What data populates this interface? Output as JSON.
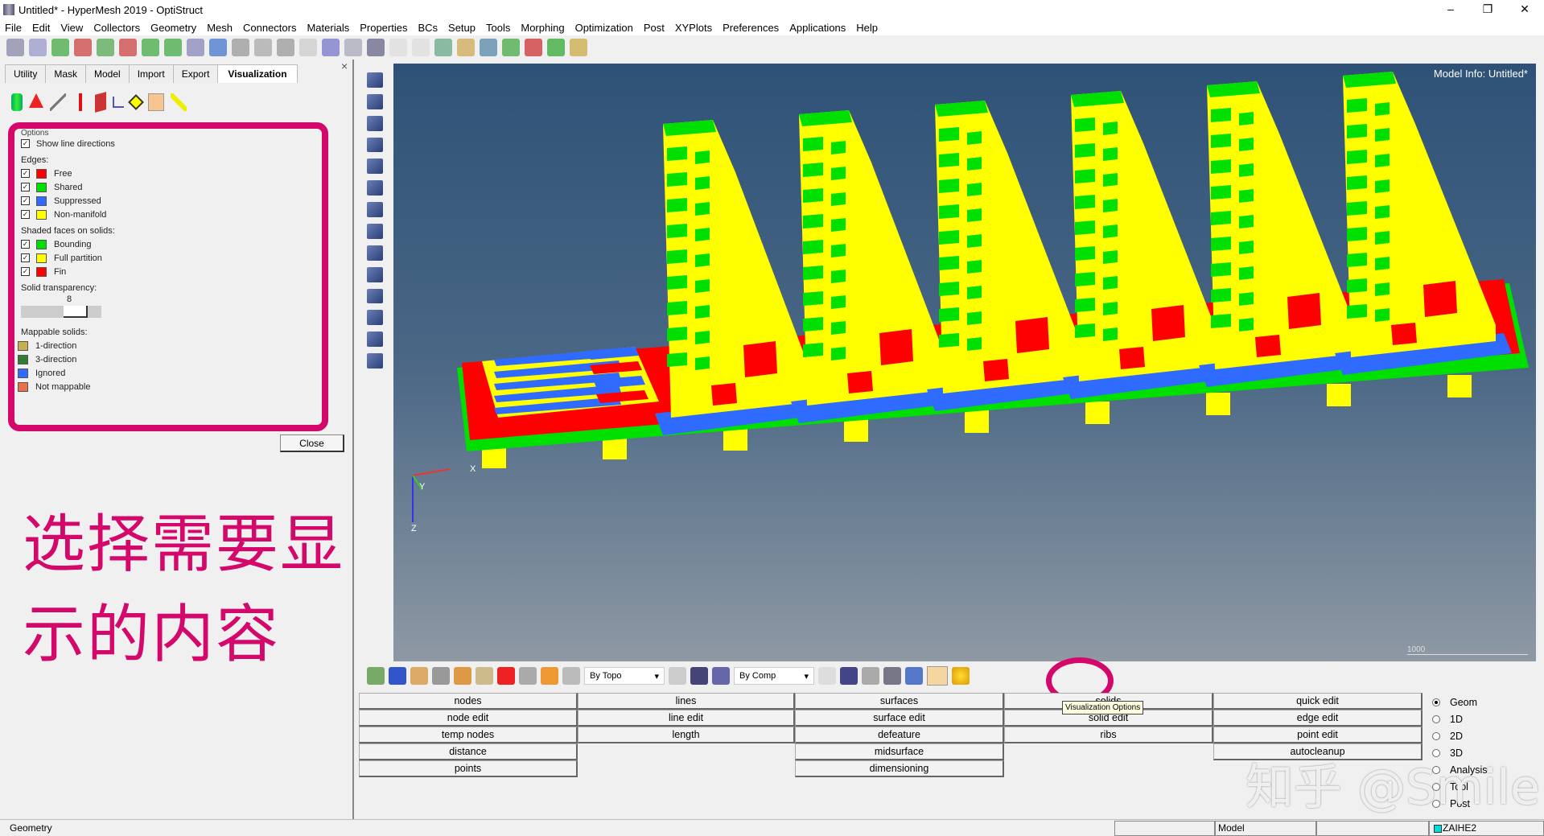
{
  "window": {
    "title": "Untitled* - HyperMesh 2019 - OptiStruct",
    "minimize": "–",
    "maximize": "❐",
    "close": "✕"
  },
  "menu": [
    "File",
    "Edit",
    "View",
    "Collectors",
    "Geometry",
    "Mesh",
    "Connectors",
    "Materials",
    "Properties",
    "BCs",
    "Setup",
    "Tools",
    "Morphing",
    "Optimization",
    "Post",
    "XYPlots",
    "Preferences",
    "Applications",
    "Help"
  ],
  "panel": {
    "tabs": [
      "Utility",
      "Mask",
      "Model",
      "Import",
      "Export",
      "Visualization"
    ],
    "active_tab": "Visualization",
    "close_x": "×",
    "options_label": "Options",
    "show_line_directions": "Show line directions",
    "edges_label": "Edges:",
    "edges": [
      {
        "label": "Free",
        "color": "#ff0000",
        "checked": true
      },
      {
        "label": "Shared",
        "color": "#00e000",
        "checked": true
      },
      {
        "label": "Suppressed",
        "color": "#2f6bff",
        "checked": true
      },
      {
        "label": "Non-manifold",
        "color": "#ffff00",
        "checked": true
      }
    ],
    "shaded_label": "Shaded faces on solids:",
    "shaded": [
      {
        "label": "Bounding",
        "color": "#00e000",
        "checked": true
      },
      {
        "label": "Full partition",
        "color": "#ffff00",
        "checked": true
      },
      {
        "label": "Fin",
        "color": "#ff0000",
        "checked": true
      }
    ],
    "transparency_label": "Solid transparency:",
    "transparency_value": "8",
    "mappable_label": "Mappable solids:",
    "mappable": [
      {
        "label": "1-direction",
        "color": "#c8b050"
      },
      {
        "label": "3-direction",
        "color": "#2e7d32"
      },
      {
        "label": "Ignored",
        "color": "#2f6bff"
      },
      {
        "label": "Not mappable",
        "color": "#e8704a"
      }
    ],
    "close_button": "Close"
  },
  "annotation": "选择需要显示的内容",
  "viewport": {
    "model_info": "Model Info: Untitled*",
    "scale": "1000",
    "axis_x": "X",
    "axis_y": "Y",
    "axis_z": "Z"
  },
  "bottom_toolbar": {
    "topo_select": "By Topo",
    "comp_select": "By Comp",
    "viz_options_tooltip": "Visualization Options"
  },
  "grid": [
    [
      "nodes",
      "lines",
      "surfaces",
      "solids",
      "quick edit"
    ],
    [
      "node edit",
      "line edit",
      "surface edit",
      "solid edit",
      "edge edit"
    ],
    [
      "temp nodes",
      "length",
      "defeature",
      "ribs",
      "point edit"
    ],
    [
      "distance",
      "",
      "midsurface",
      "",
      "autocleanup"
    ],
    [
      "points",
      "",
      "dimensioning",
      "",
      ""
    ]
  ],
  "radios": [
    {
      "label": "Geom",
      "selected": true
    },
    {
      "label": "1D"
    },
    {
      "label": "2D"
    },
    {
      "label": "3D"
    },
    {
      "label": "Analysis"
    },
    {
      "label": "Tool"
    },
    {
      "label": "Post"
    }
  ],
  "watermark": "知乎 @Smile",
  "status": {
    "left": "Geometry",
    "model": "Model",
    "component": "ZAIHE2"
  }
}
